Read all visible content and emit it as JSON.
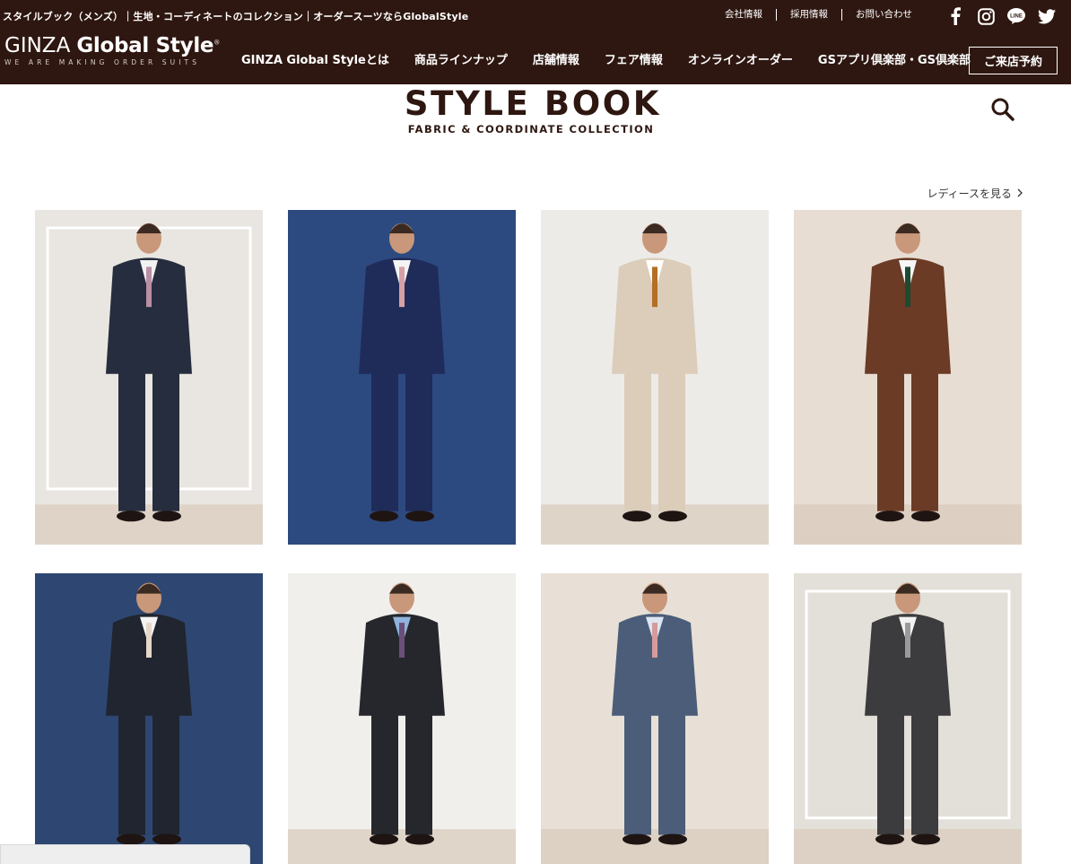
{
  "header": {
    "breadcrumb": "スタイルブック（メンズ）｜生地・コーディネートのコレクション｜オーダースーツならGlobalStyle",
    "top_links": [
      "会社情報",
      "採用情報",
      "お問い合わせ"
    ],
    "sns": [
      "facebook-icon",
      "instagram-icon",
      "line-icon",
      "twitter-icon"
    ],
    "logo_ginza": "GINZA",
    "logo_brand": "Global Style",
    "logo_reg": "®",
    "logo_tagline": "WE ARE MAKING ORDER SUITS",
    "nav": [
      "GINZA Global Styleとは",
      "商品ラインナップ",
      "店舗情報",
      "フェア情報",
      "オンラインオーダー",
      "GSアプリ倶楽部・GS倶楽部"
    ],
    "reserve_label": "ご来店予約"
  },
  "page": {
    "title": "STYLE BOOK",
    "subtitle": "FABRIC & COORDINATE COLLECTION",
    "ladies_link": "レディースを見る"
  },
  "gallery": [
    {
      "name": "style-photo-navy-three-piece",
      "bg": "#e9e6e1",
      "suit": "#262d3e",
      "tie": "#b98fa6",
      "shirt": "#f2f2f2"
    },
    {
      "name": "style-photo-blue-stripe-suit",
      "bg": "#2c4a80",
      "suit": "#1f2b59",
      "tie": "#d7a0a6",
      "shirt": "#f4f4f4"
    },
    {
      "name": "style-photo-beige-double-breasted",
      "bg": "#ecebe8",
      "suit": "#dbcdb9",
      "tie": "#b36f24",
      "shirt": "#ffffff"
    },
    {
      "name": "style-photo-brown-suit",
      "bg": "#e8ddd2",
      "suit": "#6b3b26",
      "tie": "#1e4a32",
      "shirt": "#f6f6f6"
    },
    {
      "name": "style-photo-charcoal-three-piece",
      "bg": "#2e4772",
      "suit": "#20252f",
      "tie": "#e6d7c8",
      "shirt": "#f4f4f4"
    },
    {
      "name": "style-photo-dark-suit-blue-shirt",
      "bg": "#f1efec",
      "suit": "#25272c",
      "tie": "#6b4f78",
      "shirt": "#8fb3dc"
    },
    {
      "name": "style-photo-grey-blue-double-breasted",
      "bg": "#e8e0d6",
      "suit": "#4b5d79",
      "tie": "#d59b9b",
      "shirt": "#dde6f0"
    },
    {
      "name": "style-photo-grey-stripe-suit",
      "bg": "#e3dfd9",
      "suit": "#3c3c3e",
      "tie": "#9a9a9a",
      "shirt": "#f2f2f2"
    }
  ]
}
